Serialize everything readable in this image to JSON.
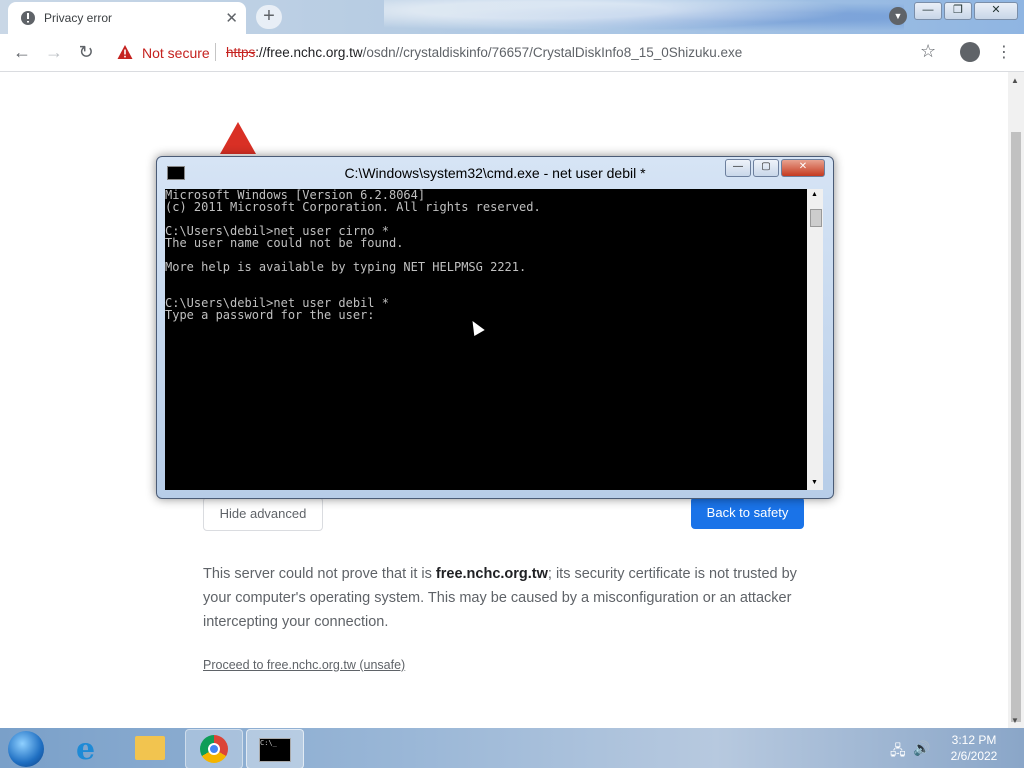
{
  "browser": {
    "tab": {
      "title": "Privacy error"
    },
    "security_label": "Not secure",
    "url": {
      "scheme": "https",
      "host": "://free.nchc.org.tw",
      "path": "/osdn//crystaldiskinfo/76657/CrystalDiskInfo8_15_0Shizuku.exe"
    }
  },
  "page": {
    "hide_advanced": "Hide advanced",
    "back_to_safety": "Back to safety",
    "explanation_prefix": "This server could not prove that it is ",
    "explanation_host": "free.nchc.org.tw",
    "explanation_suffix": "; its security certificate is not trusted by your computer's operating system. This may be caused by a misconfiguration or an attacker intercepting your connection.",
    "proceed_link": "Proceed to free.nchc.org.tw (unsafe)"
  },
  "cmd": {
    "title": "C:\\Windows\\system32\\cmd.exe - net  user debil *",
    "lines": [
      "Microsoft Windows [Version 6.2.8064]",
      "(c) 2011 Microsoft Corporation. All rights reserved.",
      "",
      "C:\\Users\\debil>net user cirno *",
      "The user name could not be found.",
      "",
      "More help is available by typing NET HELPMSG 2221.",
      "",
      "",
      "C:\\Users\\debil>net user debil *",
      "Type a password for the user:"
    ]
  },
  "taskbar": {
    "time": "3:12 PM",
    "date": "2/6/2022",
    "apps": [
      "internet-explorer",
      "windows-explorer",
      "google-chrome",
      "command-prompt"
    ]
  },
  "colors": {
    "danger": "#c5221f",
    "primary_button": "#1a73e8",
    "console_bg": "#000000",
    "console_fg": "#c0c0c0"
  }
}
